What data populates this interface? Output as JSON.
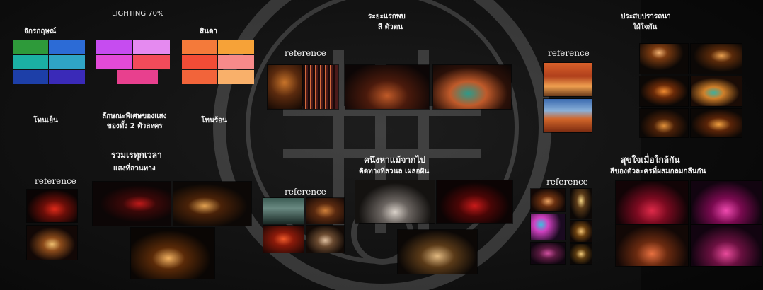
{
  "labels": {
    "color_wheel": "จักรกฤษณ์",
    "lighting": "LIGHTING 70%",
    "product": "สินดา",
    "first_meet_1": "ระยะแรกพบ",
    "first_meet_2": "สี ตัวตน",
    "wish_1": "ประสบปรารถนา",
    "wish_2": "ใฝ่ใจกัน",
    "cool_tone": "โทนเย็น",
    "special_1": "ลักษณะพิเศษของแสง",
    "special_2": "ของทั้ง 2 ตัวละคร",
    "warm_tone": "โทนร้อน",
    "gather_1": "รวมเรทุกเวลา",
    "gather_2": "แสงที่ลวนทาง",
    "longing_1": "คนึงหาแม้จากไป",
    "longing_2": "คิดทางที่ลวนล เผลอฝัน",
    "happy_1": "สุขใจเมื่อใกล้กัน",
    "happy_2": "สีของตัวละครที่ผสมกลมกลืนกัน"
  },
  "reference_label": "reference",
  "colors": {
    "background": "#121212",
    "cool_swatches": [
      "#2e9a3a",
      "#2c6bd6",
      "#1bb0a4",
      "#2fa4c6",
      "#1d3fa8",
      "#3a2ab8"
    ],
    "lighting_swatches": [
      "#c64cf0",
      "#e24ad8",
      "#f06a8a",
      "#f24b5a",
      "#e8408e"
    ],
    "warm_swatches": [
      "#f47a3a",
      "#f6a238",
      "#f24c36",
      "#f78a8a",
      "#f2643a",
      "#f9b06a"
    ]
  }
}
